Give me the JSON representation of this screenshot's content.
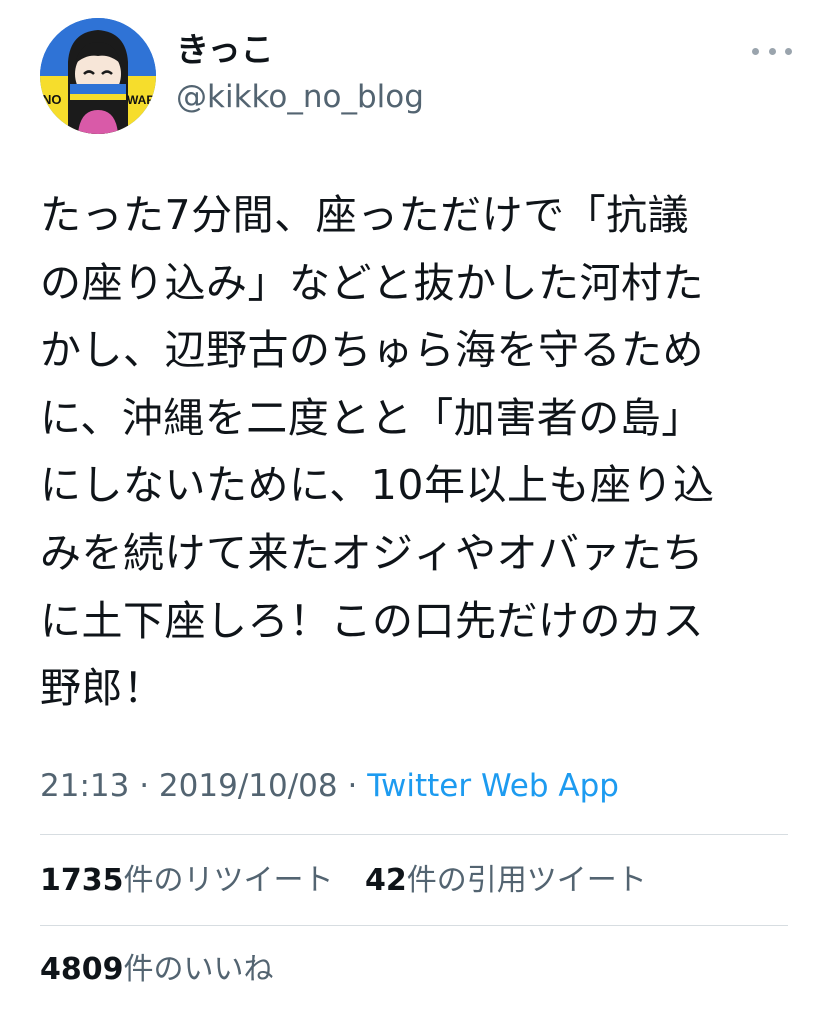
{
  "tweet": {
    "author": {
      "display_name": "きっこ",
      "handle": "@kikko_no_blog",
      "avatar_texts": {
        "left": "NO",
        "right": "WAR"
      }
    },
    "text": "たった7分間、座っただけで「抗議\nの座り込み」などと抜かした河村た\nかし、辺野古のちゅら海を守るため\nに、沖縄を二度とと「加害者の島」\nにしないために、10年以上も座り込\nみを続けて来たオジィやオバァたち\nに土下座しろ！この口先だけのカス\n野郎！",
    "time": "21:13",
    "separator": "·",
    "date": "2019/10/08",
    "source": "Twitter Web App",
    "stats": {
      "retweets_count": "1735",
      "retweets_label": "件のリツイート",
      "quotes_count": "42",
      "quotes_label": "件の引用ツイート",
      "likes_count": "4809",
      "likes_label": "件のいいね"
    }
  },
  "colors": {
    "text": "#0f1419",
    "secondary": "#536471",
    "link": "#1d9bf0",
    "divider": "#d7dde1"
  }
}
